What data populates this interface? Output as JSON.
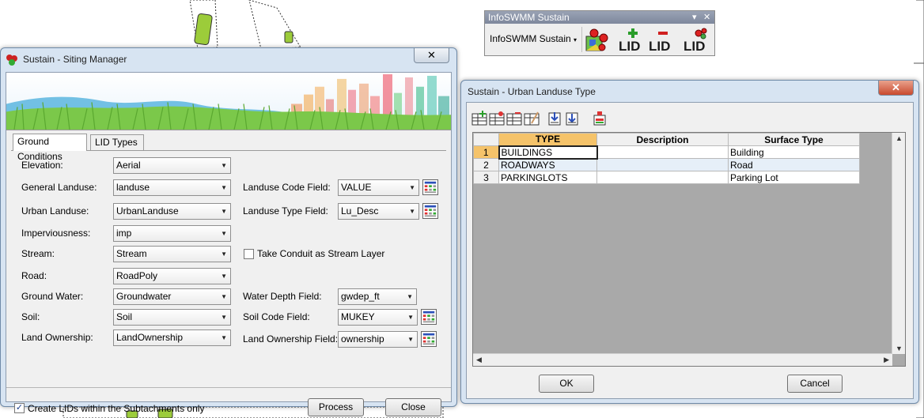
{
  "toolbar": {
    "title": "InfoSWMM Sustain",
    "menu_label": "InfoSWMM Sustain",
    "lid_label": "LID",
    "icons": [
      "map-layers-icon",
      "add-lid-icon",
      "remove-lid-icon",
      "lid-settings-icon"
    ]
  },
  "siting": {
    "title": "Sustain - Siting Manager",
    "tabs": [
      "Ground Conditions",
      "LID Types"
    ],
    "fields": {
      "elevation": {
        "label": "Elevation:",
        "value": "Aerial"
      },
      "general_landuse": {
        "label": "General Landuse:",
        "value": "landuse"
      },
      "urban_landuse": {
        "label": "Urban Landuse:",
        "value": "UrbanLanduse"
      },
      "imperviousness": {
        "label": "Imperviousness:",
        "value": "imp"
      },
      "stream": {
        "label": "Stream:",
        "value": "Stream"
      },
      "road": {
        "label": "Road:",
        "value": "RoadPoly"
      },
      "ground_water": {
        "label": "Ground Water:",
        "value": "Groundwater"
      },
      "soil": {
        "label": "Soil:",
        "value": "Soil"
      },
      "land_ownership": {
        "label": "Land Ownership:",
        "value": "LandOwnership"
      },
      "landuse_code_field": {
        "label": "Landuse Code Field:",
        "value": "VALUE"
      },
      "landuse_type_field": {
        "label": "Landuse Type Field:",
        "value": "Lu_Desc"
      },
      "water_depth_field": {
        "label": "Water Depth Field:",
        "value": "gwdep_ft"
      },
      "soil_code_field": {
        "label": "Soil Code Field:",
        "value": "MUKEY"
      },
      "land_ownership_field": {
        "label": "Land Ownership Field:",
        "value": "ownership"
      }
    },
    "take_conduit_label": "Take Conduit as Stream Layer",
    "take_conduit_checked": false,
    "create_lids_label": "Create LIDs within the Subtachments only",
    "create_lids_checked": true,
    "process_label": "Process",
    "close_label": "Close"
  },
  "urban": {
    "title": "Sustain - Urban Landuse Type",
    "columns": [
      "TYPE",
      "Description",
      "Surface Type"
    ],
    "rows": [
      {
        "num": "1",
        "type": "BUILDINGS",
        "description": "",
        "surface": "Building"
      },
      {
        "num": "2",
        "type": "ROADWAYS",
        "description": "",
        "surface": "Road"
      },
      {
        "num": "3",
        "type": "PARKINGLOTS",
        "description": "",
        "surface": "Parking Lot"
      }
    ],
    "ok_label": "OK",
    "cancel_label": "Cancel"
  },
  "close_glyph": "✕",
  "colors": {
    "selected_header": "#f5c36a",
    "window_frame": "#d7e4f2",
    "map_polygon": "#9ccc3a"
  }
}
